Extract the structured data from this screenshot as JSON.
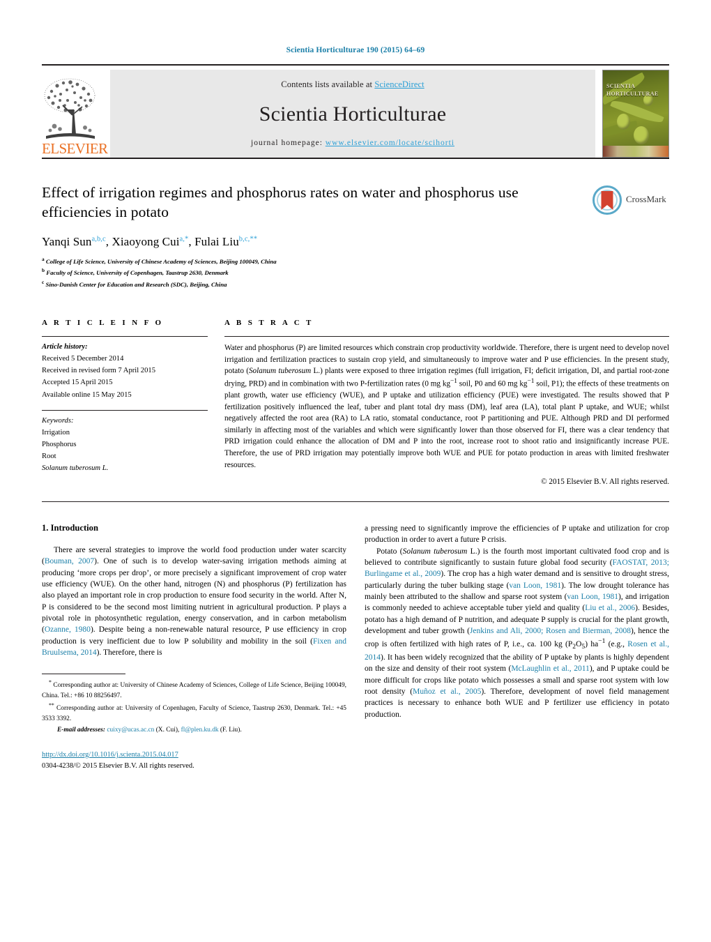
{
  "running_head": "Scientia Horticulturae 190 (2015) 64–69",
  "masthead": {
    "contents_prefix": "Contents lists available at ",
    "sciencedirect": "ScienceDirect",
    "journal_name": "Scientia Horticulturae",
    "homepage_label": "journal homepage:",
    "homepage_url": "www.elsevier.com/locate/scihorti",
    "publisher_logo_text": "ELSEVIER",
    "cover_title_line1": "SCIENTIA",
    "cover_title_line2": "HORTICULTURAE"
  },
  "article": {
    "title": "Effect of irrigation regimes and phosphorus rates on water and phosphorus use efficiencies in potato",
    "authors_html": "Yanqi Sun<sup>a,b,c</sup>, Xiaoyong Cui<sup>a,*</sup>, Fulai Liu<sup>b,c,**</sup>",
    "affiliations": [
      {
        "marker": "a",
        "text": "College of Life Science, University of Chinese Academy of Sciences, Beijing 100049, China"
      },
      {
        "marker": "b",
        "text": "Faculty of Science, University of Copenhagen, Taastrup 2630, Denmark"
      },
      {
        "marker": "c",
        "text": "Sino-Danish Center for Education and Research (SDC), Beijing, China"
      }
    ],
    "crossmark_label": "CrossMark"
  },
  "article_info": {
    "heading": "A R T I C L E    I N F O",
    "history_label": "Article history:",
    "history": [
      "Received 5 December 2014",
      "Received in revised form 7 April 2015",
      "Accepted 15 April 2015",
      "Available online 15 May 2015"
    ],
    "keywords_label": "Keywords:",
    "keywords": [
      "Irrigation",
      "Phosphorus",
      "Root"
    ],
    "keyword_italic": "Solanum tuberosum L."
  },
  "abstract": {
    "heading": "A B S T R A C T",
    "paragraph_html": "Water and phosphorus (P) are limited resources which constrain crop productivity worldwide. Therefore, there is urgent need to develop novel irrigation and fertilization practices to sustain crop yield, and simultaneously to improve water and P use efficiencies. In the present study, potato (<span class=\"ital\">Solanum tuberosum</span> L.) plants were exposed to three irrigation regimes (full irrigation, FI; deficit irrigation, DI, and partial root-zone drying, PRD) and in combination with two P-fertilization rates (0 mg kg<sup>&minus;1</sup> soil, P0 and 60 mg kg<sup>&minus;1</sup> soil, P1); the effects of these treatments on plant growth, water use efficiency (WUE), and P uptake and utilization efficiency (PUE) were investigated. The results showed that P fertilization positively influenced the leaf, tuber and plant total dry mass (DM), leaf area (LA), total plant P uptake, and WUE; whilst negatively affected the root area (RA) to LA ratio, stomatal conductance, root P partitioning and PUE. Although PRD and DI performed similarly in affecting most of the variables and which were significantly lower than those observed for FI, there was a clear tendency that PRD irrigation could enhance the allocation of DM and P into the root, increase root to shoot ratio and insignificantly increase PUE. Therefore, the use of PRD irrigation may potentially improve both WUE and PUE for potato production in areas with limited freshwater resources.",
    "copyright": "© 2015 Elsevier B.V. All rights reserved."
  },
  "introduction": {
    "number_title": "1.  Introduction",
    "left_paragraph_html": "There are several strategies to improve the world food production under water scarcity (<a class=\"ref\" href=\"#\">Bouman, 2007</a>). One of such is to develop water-saving irrigation methods aiming at producing &lsquo;more crops per drop&rsquo;, or more precisely a significant improvement of crop water use efficiency (WUE). On the other hand, nitrogen (N) and phosphorus (P) fertilization has also played an important role in crop production to ensure food security in the world. After N, P is considered to be the second most limiting nutrient in agricultural production. P plays a pivotal role in photosynthetic regulation, energy conservation, and in carbon metabolism (<a class=\"ref\" href=\"#\">Ozanne, 1980</a>). Despite being a non-renewable natural resource, P use efficiency in crop production is very inefficient due to low P solubility and mobility in the soil (<a class=\"ref\" href=\"#\">Fixen and Bruulsema, 2014</a>). Therefore, there is",
    "right_paragraph_1_html": "a pressing need to significantly improve the efficiencies of P uptake and utilization for crop production in order to avert a future P crisis.",
    "right_paragraph_2_html": "Potato (<span class=\"ital\">Solanum tuberosum</span> L.) is the fourth most important cultivated food crop and is believed to contribute significantly to sustain future global food security (<a class=\"ref\" href=\"#\">FAOSTAT, 2013; Burlingame et al., 2009</a>). The crop has a high water demand and is sensitive to drought stress, particularly during the tuber bulking stage (<a class=\"ref\" href=\"#\">van Loon, 1981</a>). The low drought tolerance has mainly been attributed to the shallow and sparse root system (<a class=\"ref\" href=\"#\">van Loon, 1981</a>), and irrigation is commonly needed to achieve acceptable tuber yield and quality (<a class=\"ref\" href=\"#\">Liu et al., 2006</a>). Besides, potato has a high demand of P nutrition, and adequate P supply is crucial for the plant growth, development and tuber growth (<a class=\"ref\" href=\"#\">Jenkins and Ali, 2000; Rosen and Bierman, 2008</a>), hence the crop is often fertilized with high rates of P, i.e., ca. 100 kg (P<sub>2</sub>O<sub>5</sub>) ha<sup>&minus;1</sup> (e.g., <a class=\"ref\" href=\"#\">Rosen et al., 2014</a>). It has been widely recognized that the ability of P uptake by plants is highly dependent on the size and density of their root system (<a class=\"ref\" href=\"#\">McLaughlin et al., 2011</a>), and P uptake could be more difficult for crops like potato which possesses a small and sparse root system with low root density (<a class=\"ref\" href=\"#\">Mu&ntilde;oz et al., 2005</a>). Therefore, development of novel field management practices is necessary to enhance both WUE and P fertilizer use efficiency in potato production."
  },
  "footnotes": {
    "note1_html": "<sup>*</sup> Corresponding author at: University of Chinese Academy of Sciences, College of Life Science, Beijing 100049, China. Tel.: +86 10 88256497.",
    "note2_html": "<sup>**</sup> Corresponding author at: University of Copenhagen, Faculty of Science, Taastrup 2630, Denmark. Tel.: +45 3533 3392.",
    "email_label": "E-mail addresses:",
    "email1": "cuixy@ucas.ac.cn",
    "email1_owner": "(X. Cui),",
    "email2": "fl@plen.ku.dk",
    "email2_owner": "(F. Liu).",
    "doi": "http://dx.doi.org/10.1016/j.scienta.2015.04.017",
    "issn_line": "0304-4238/© 2015 Elsevier B.V. All rights reserved."
  }
}
